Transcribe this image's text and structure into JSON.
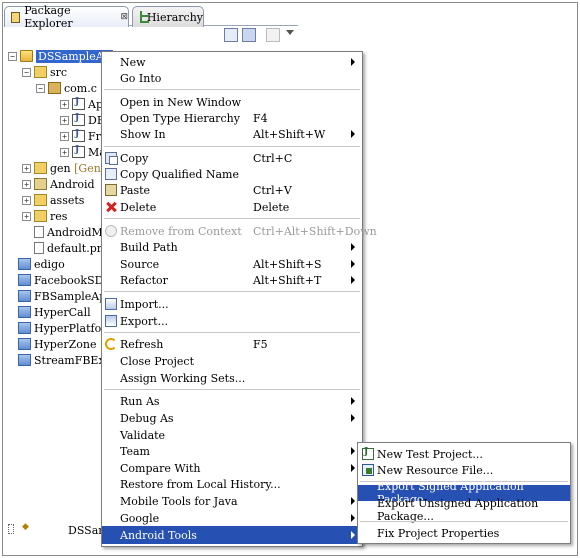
{
  "tabs": [
    {
      "label": "Package Explorer",
      "close": "⊠"
    },
    {
      "label": "Hierarchy"
    }
  ],
  "tree": {
    "project": "DSSampleAp",
    "src": "src",
    "package": "com.c",
    "java_files": [
      "Ap",
      "DE",
      "Fr",
      "Ma"
    ],
    "gen": "gen",
    "gen_suffix": "[Gen",
    "android_lib": "Android",
    "assets": "assets",
    "res": "res",
    "manifest": "AndroidM",
    "default_props": "default.pr",
    "projects": [
      "edigo",
      "FacebookSD",
      "FBSampleAp",
      "HyperCall",
      "HyperPlatfor",
      "HyperZone",
      "StreamFBEx"
    ]
  },
  "status": {
    "text": "DSSam"
  },
  "menu": {
    "new": "New",
    "go_into": "Go Into",
    "open_new_window": "Open in New Window",
    "open_type_hierarchy": "Open Type Hierarchy",
    "open_type_hierarchy_accel": "F4",
    "show_in": "Show In",
    "show_in_accel": "Alt+Shift+W",
    "copy": "Copy",
    "copy_accel": "Ctrl+C",
    "copy_qualified": "Copy Qualified Name",
    "paste": "Paste",
    "paste_accel": "Ctrl+V",
    "delete": "Delete",
    "delete_accel": "Delete",
    "remove_context": "Remove from Context",
    "remove_context_accel": "Ctrl+Alt+Shift+Down",
    "build_path": "Build Path",
    "source": "Source",
    "source_accel": "Alt+Shift+S",
    "refactor": "Refactor",
    "refactor_accel": "Alt+Shift+T",
    "import": "Import...",
    "export": "Export...",
    "refresh": "Refresh",
    "refresh_accel": "F5",
    "close_project": "Close Project",
    "assign_working_sets": "Assign Working Sets...",
    "run_as": "Run As",
    "debug_as": "Debug As",
    "validate": "Validate",
    "team": "Team",
    "compare_with": "Compare With",
    "restore_local_history": "Restore from Local History...",
    "mobile_tools_java": "Mobile Tools for Java",
    "google": "Google",
    "android_tools": "Android Tools"
  },
  "submenu": {
    "new_test_project": "New Test Project...",
    "new_resource_file": "New Resource File...",
    "export_signed": "Export Signed Application Package...",
    "export_unsigned": "Export Unsigned Application Package...",
    "fix_project_properties": "Fix Project Properties"
  },
  "colors": {
    "highlight": "#2651b2",
    "selected_tree": "#3366cc",
    "disabled_text": "#9a9a9a"
  }
}
